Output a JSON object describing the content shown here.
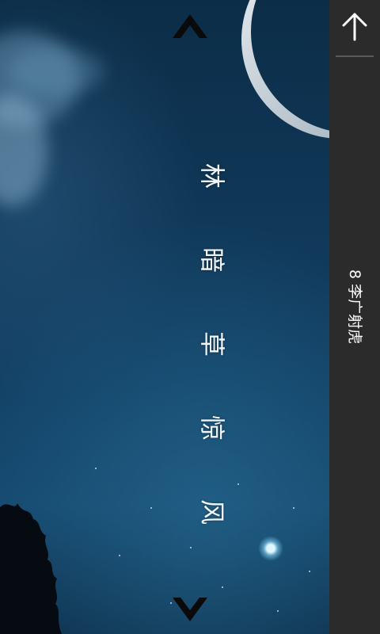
{
  "header": {
    "title": "8 李广射虎"
  },
  "poem": {
    "chars": [
      "林",
      "暗",
      "草",
      "惊",
      "风"
    ]
  },
  "icons": {
    "back": "back-arrow-icon",
    "up": "chevron-up-icon",
    "down": "chevron-down-icon"
  },
  "colors": {
    "sidebar_bg": "#2b2b2b",
    "text": "#ffffff",
    "sky_top": "#0c2d47",
    "sky_mid": "#123f63"
  }
}
